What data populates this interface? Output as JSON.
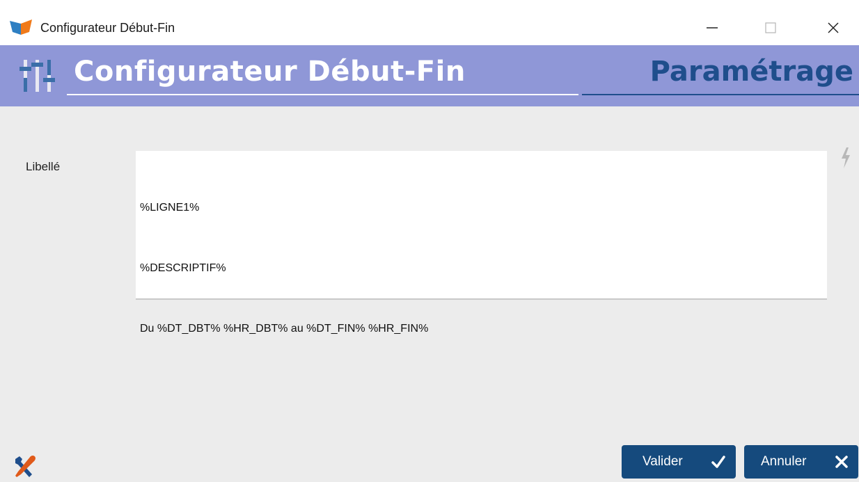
{
  "window": {
    "title": "Configurateur Début-Fin",
    "controls": {
      "minimize": "minimize-icon",
      "maximize": "maximize-icon",
      "close": "close-icon"
    }
  },
  "header": {
    "title": "Configurateur Début-Fin",
    "section": "Paramétrage",
    "icon": "sliders-icon",
    "band_color": "#8f97d7",
    "section_color": "#1f4e8c"
  },
  "form": {
    "label": "Libellé",
    "lines": [
      "%LIGNE1%",
      "%DESCRIPTIF%",
      "Du %DT_DBT% %HR_DBT% au %DT_FIN% %HR_FIN%"
    ],
    "side_icon": "lightning-icon"
  },
  "footer": {
    "tools_icon": "tools-icon",
    "valider_label": "Valider",
    "annuler_label": "Annuler",
    "button_color": "#154a7d"
  }
}
